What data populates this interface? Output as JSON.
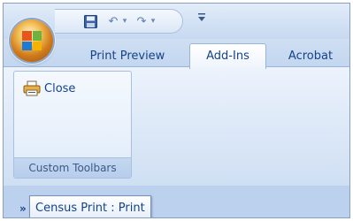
{
  "quick_access": {
    "icons": [
      "office-button",
      "save-icon",
      "undo-icon",
      "redo-icon",
      "customize-icon"
    ],
    "undo_dropdown": "▾",
    "redo_dropdown": "▾",
    "customize": "₹"
  },
  "tabs": [
    {
      "label": "Print Preview",
      "active": false
    },
    {
      "label": "Add-Ins",
      "active": true
    },
    {
      "label": "Acrobat",
      "active": false
    }
  ],
  "ribbon": {
    "groups": [
      {
        "label": "Custom Toolbars",
        "buttons": [
          {
            "label": "Close",
            "icon": "printer-icon"
          }
        ]
      }
    ]
  },
  "bottom": {
    "chevron": "»",
    "tooltip": "Census Print : Print"
  },
  "colors": {
    "accent": "#15428b",
    "ribbon_bg": "#dde9f8",
    "tab_active_bg": "#ffffff"
  }
}
